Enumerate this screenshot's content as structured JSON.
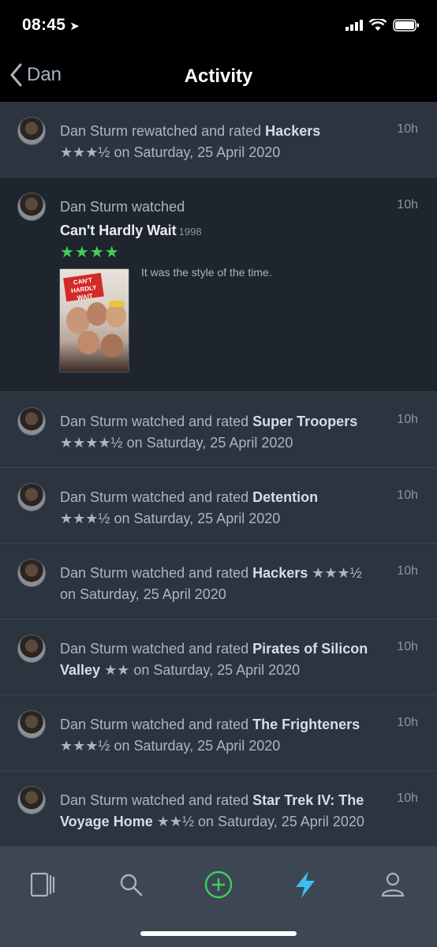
{
  "status": {
    "time": "08:45"
  },
  "nav": {
    "back_label": "Dan",
    "title": "Activity"
  },
  "feed": [
    {
      "user": "Dan Sturm",
      "action": "rewatched and rated",
      "film": "Hackers",
      "rating": "★★★½",
      "suffix": "on Saturday, 25 April 2020",
      "time": "10h"
    },
    {
      "user": "Dan Sturm",
      "action": "watched",
      "film": "Can't Hardly Wait",
      "year": "1998",
      "rating": "★★★★",
      "review": "It was the style of the time.",
      "poster_text": "CAN'T HARDLY WAIT",
      "time": "10h"
    },
    {
      "user": "Dan Sturm",
      "action": "watched and rated",
      "film": "Super Troopers",
      "rating": "★★★★½",
      "suffix": "on Saturday, 25 April 2020",
      "time": "10h"
    },
    {
      "user": "Dan Sturm",
      "action": "watched and rated",
      "film": "Detention",
      "rating": "★★★½",
      "suffix": "on Saturday, 25 April 2020",
      "time": "10h"
    },
    {
      "user": "Dan Sturm",
      "action": "watched and rated",
      "film": "Hackers",
      "rating": "★★★½",
      "suffix": "on Saturday, 25 April 2020",
      "time": "10h"
    },
    {
      "user": "Dan Sturm",
      "action": "watched and rated",
      "film": "Pirates of Silicon Valley",
      "rating": "★★",
      "suffix": "on Saturday, 25 April 2020",
      "time": "10h"
    },
    {
      "user": "Dan Sturm",
      "action": "watched and rated",
      "film": "The Frighteners",
      "rating": "★★★½",
      "suffix": "on Saturday, 25 April 2020",
      "time": "10h"
    },
    {
      "user": "Dan Sturm",
      "action": "watched and rated",
      "film": "Star Trek IV: The Voyage Home",
      "rating": "★★½",
      "suffix": "on Saturday, 25 April 2020",
      "time": "10h"
    }
  ],
  "tabbar": {
    "items": [
      "films-icon",
      "search-icon",
      "add-icon",
      "activity-icon",
      "profile-icon"
    ],
    "active": "activity-icon",
    "accent_add": "#3fd05a",
    "accent_active": "#40bcf4"
  }
}
